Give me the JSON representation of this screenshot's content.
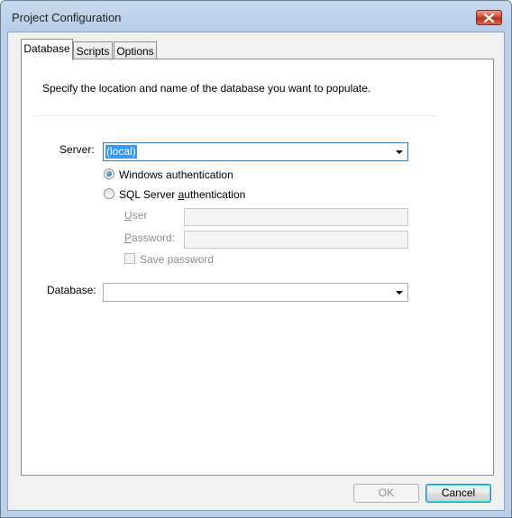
{
  "window": {
    "title": "Project Configuration"
  },
  "tabs": [
    {
      "label": "Database",
      "active": true
    },
    {
      "label": "Scripts",
      "active": false
    },
    {
      "label": "Options",
      "active": false
    }
  ],
  "database_tab": {
    "description": "Specify the location and name of the database you want to populate.",
    "server_label": "Server:",
    "server_value": "(local)",
    "auth_windows_label": "Windows authentication",
    "auth_sql_label_pre": "SQL Server ",
    "auth_sql_label_ul": "a",
    "auth_sql_label_post": "uthentication",
    "selected_auth": "windows",
    "user_label_ul": "U",
    "user_label_post": "ser",
    "user_value": "",
    "password_label_ul": "P",
    "password_label_post": "assword:",
    "password_value": "",
    "save_password_label": "Save password",
    "save_password_checked": false,
    "database_label": "Database:",
    "database_value": ""
  },
  "buttons": {
    "ok": "OK",
    "cancel": "Cancel"
  }
}
